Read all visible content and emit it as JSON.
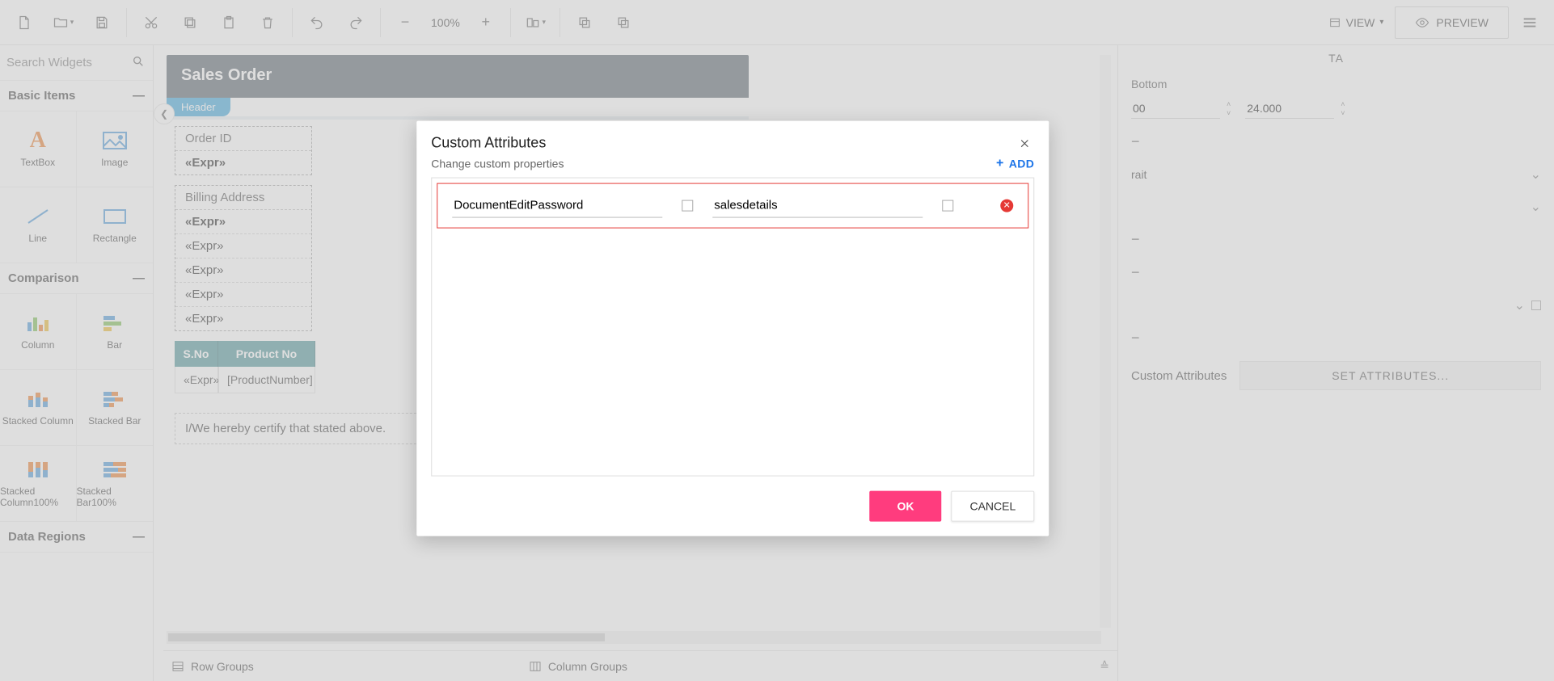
{
  "toolbar": {
    "zoom": "100%",
    "view_label": "VIEW",
    "preview_label": "PREVIEW"
  },
  "widgets": {
    "search_placeholder": "Search Widgets",
    "sections": {
      "basic": "Basic Items",
      "comparison": "Comparison",
      "data_regions": "Data Regions"
    },
    "items": {
      "textbox": "TextBox",
      "image": "Image",
      "line": "Line",
      "rectangle": "Rectangle",
      "column": "Column",
      "bar": "Bar",
      "stacked_column": "Stacked Column",
      "stacked_bar": "Stacked Bar",
      "stacked_column100": "Stacked Column100%",
      "stacked_bar100": "Stacked Bar100%"
    }
  },
  "report": {
    "title": "Sales Order",
    "header_tab": "Header",
    "order_id_label": "Order ID",
    "expr_bold": "«Expr»",
    "billing_label": "Billing Address",
    "expr": "«Expr»",
    "th_sno": "S.No",
    "th_prod": "Product No",
    "td_prod": "[ProductNumber]",
    "cert_text": "I/We hereby certify that stated above."
  },
  "groups": {
    "row": "Row Groups",
    "column": "Column Groups"
  },
  "props": {
    "tab_label": "TA",
    "bottom_label": "Bottom",
    "val1": "00",
    "val2": "24.000",
    "orientation": "rait",
    "custom_attr_label": "Custom Attributes",
    "set_attr_btn": "SET ATTRIBUTES..."
  },
  "modal": {
    "title": "Custom Attributes",
    "hint": "Change custom properties",
    "add_label": "ADD",
    "row": {
      "name": "DocumentEditPassword",
      "value": "salesdetails"
    },
    "ok": "OK",
    "cancel": "CANCEL"
  }
}
